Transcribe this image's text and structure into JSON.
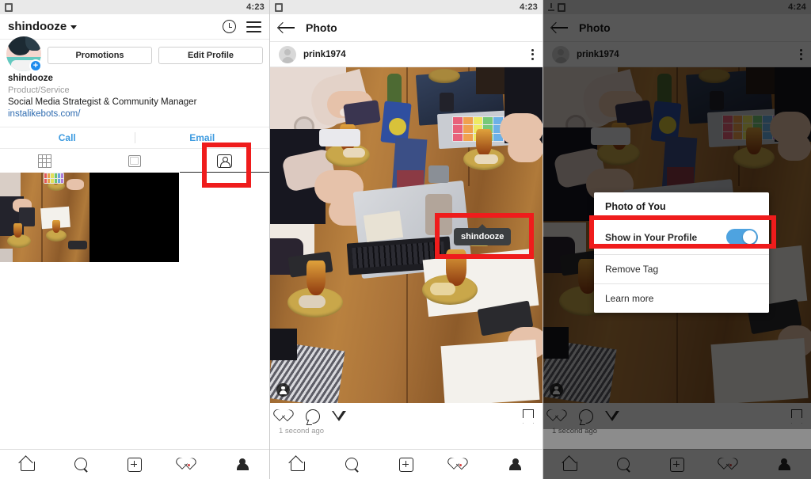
{
  "panels": [
    {
      "id": "profile-screen",
      "statusbar": {
        "time": "4:23",
        "icons": [
          "app-icon"
        ]
      },
      "header": {
        "username": "shindooze",
        "dropdown_icon": "chevron-down-icon",
        "history_icon": "clock-history-icon",
        "menu_icon": "hamburger-menu-icon"
      },
      "buttons": {
        "promotions": "Promotions",
        "edit_profile": "Edit Profile"
      },
      "bio": {
        "name": "shindooze",
        "category": "Product/Service",
        "description": "Social Media Strategist & Community Manager",
        "link": "instalikebots.com/"
      },
      "contact": {
        "call": "Call",
        "email": "Email"
      },
      "tabs": [
        {
          "name": "grid-tab",
          "icon": "grid-icon",
          "active": false
        },
        {
          "name": "list-tab",
          "icon": "square-icon",
          "active": false
        },
        {
          "name": "tagged-tab",
          "icon": "tagged-person-icon",
          "active": true
        }
      ],
      "grid": [
        {
          "name": "photo-cell-table",
          "type": "photo"
        },
        {
          "name": "photo-cell-black",
          "type": "black"
        }
      ]
    },
    {
      "id": "photo-screen",
      "statusbar": {
        "time": "4:23"
      },
      "header": {
        "back_icon": "back-arrow-icon",
        "title": "Photo"
      },
      "post": {
        "username": "prink1974",
        "avatar": "default-avatar-icon",
        "menu_icon": "kebab-menu-icon",
        "tag_badge_icon": "tagged-person-icon",
        "tag_tooltip": "shindooze"
      },
      "actions": {
        "like": "heart-icon",
        "comment": "comment-icon",
        "share": "send-icon",
        "save": "bookmark-icon"
      },
      "timestamp": "1 second ago"
    },
    {
      "id": "photo-of-you-dialog-screen",
      "statusbar": {
        "time": "4:24"
      },
      "header": {
        "back_icon": "back-arrow-icon",
        "title": "Photo"
      },
      "post": {
        "username": "prink1974",
        "menu_icon": "kebab-menu-icon"
      },
      "dialog": {
        "title": "Photo of You",
        "rows": [
          {
            "label": "Show in Your Profile",
            "control": "toggle",
            "value": "on"
          },
          {
            "label": "Remove Tag",
            "control": "none"
          },
          {
            "label": "Learn more",
            "control": "none"
          }
        ]
      },
      "actions": {
        "like": "heart-icon",
        "comment": "comment-icon",
        "share": "send-icon",
        "save": "bookmark-icon"
      },
      "timestamp": "1 second ago"
    }
  ],
  "bottom_nav": [
    {
      "name": "nav-home",
      "icon": "home-icon"
    },
    {
      "name": "nav-search",
      "icon": "search-icon"
    },
    {
      "name": "nav-add",
      "icon": "plus-box-icon"
    },
    {
      "name": "nav-activity",
      "icon": "heart-icon",
      "badge": true
    },
    {
      "name": "nav-profile",
      "icon": "person-filled-icon"
    }
  ],
  "highlights": {
    "color": "#ef1c1c",
    "boxes": [
      {
        "target": "tagged-tab"
      },
      {
        "target": "tag-tooltip"
      },
      {
        "target": "show-in-your-profile-row"
      }
    ]
  }
}
